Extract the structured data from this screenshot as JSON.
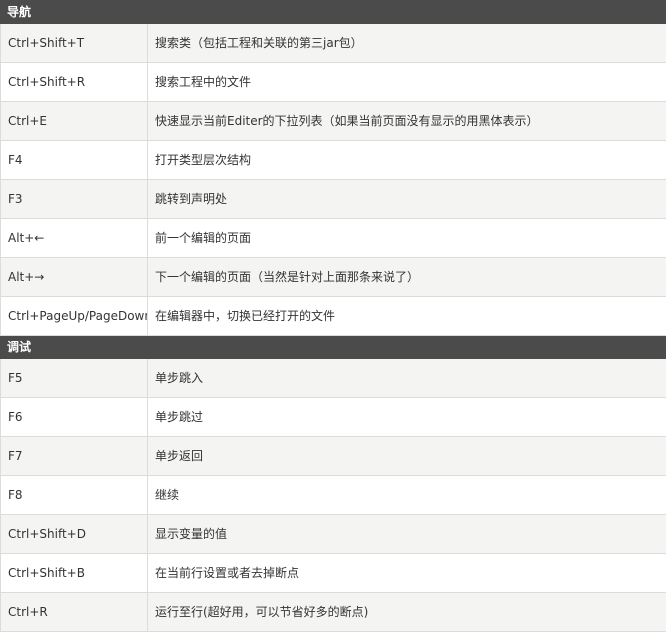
{
  "sections": [
    {
      "title": "导航",
      "rows": [
        {
          "key": "Ctrl+Shift+T",
          "desc": "搜索类（包括工程和关联的第三jar包）"
        },
        {
          "key": "Ctrl+Shift+R",
          "desc": "搜索工程中的文件"
        },
        {
          "key": "Ctrl+E",
          "desc": "快速显示当前Editer的下拉列表（如果当前页面没有显示的用黑体表示）"
        },
        {
          "key": "F4",
          "desc": "打开类型层次结构"
        },
        {
          "key": "F3",
          "desc": "跳转到声明处"
        },
        {
          "key": "Alt+←",
          "desc": "前一个编辑的页面"
        },
        {
          "key": "Alt+→",
          "desc": "下一个编辑的页面（当然是针对上面那条来说了）"
        },
        {
          "key": "Ctrl+PageUp/PageDown",
          "desc": "在编辑器中，切换已经打开的文件"
        }
      ]
    },
    {
      "title": "调试",
      "rows": [
        {
          "key": "F5",
          "desc": "单步跳入"
        },
        {
          "key": "F6",
          "desc": "单步跳过"
        },
        {
          "key": "F7",
          "desc": "单步返回"
        },
        {
          "key": "F8",
          "desc": "继续"
        },
        {
          "key": "Ctrl+Shift+D",
          "desc": "显示变量的值"
        },
        {
          "key": "Ctrl+Shift+B",
          "desc": "在当前行设置或者去掉断点"
        },
        {
          "key": "Ctrl+R",
          "desc": "运行至行(超好用，可以节省好多的断点)"
        }
      ]
    }
  ]
}
